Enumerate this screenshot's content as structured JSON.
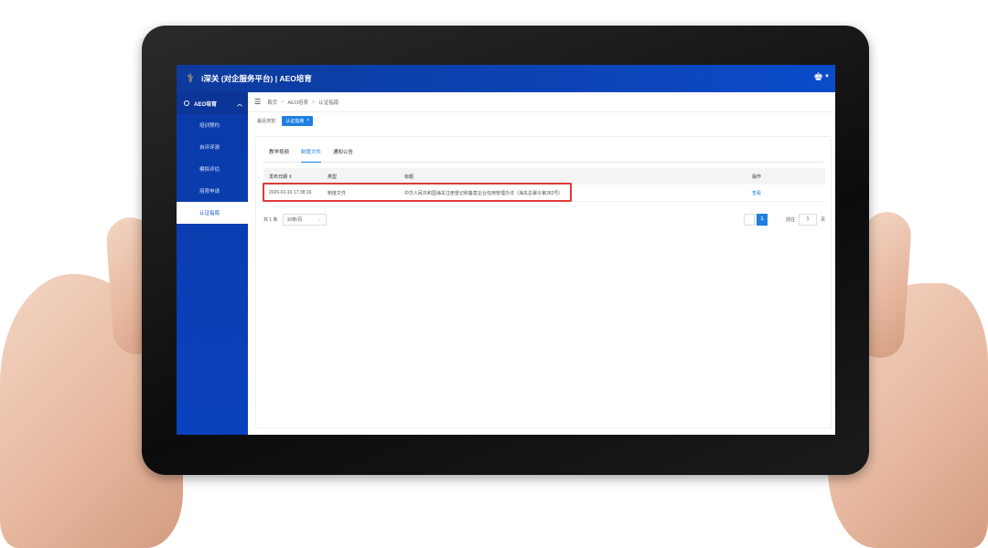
{
  "header": {
    "title": "i深关 (对企服务平台) | AEO培育"
  },
  "sidebar": {
    "group": "AEO培育",
    "items": [
      {
        "label": "培训预约"
      },
      {
        "label": "自评评测"
      },
      {
        "label": "模拟评估"
      },
      {
        "label": "培育申请"
      },
      {
        "label": "认证指南"
      }
    ]
  },
  "breadcrumb": {
    "items": [
      "首页",
      "AEO培育",
      "认证指南"
    ]
  },
  "tagbar": {
    "label": "最近浏览:",
    "active_tag": "认证指南"
  },
  "tabs": [
    {
      "label": "教学视频"
    },
    {
      "label": "制度文件"
    },
    {
      "label": "通知公告"
    }
  ],
  "table": {
    "headers": [
      "发布日期 ⇕",
      "类型",
      "标题",
      "操作"
    ],
    "rows": [
      {
        "date": "2026-01-16 17:38:16",
        "type": "制度文件",
        "title": "中华人民共和国海关注册登记和备案企业信用管理办法（海关总署令第282号）",
        "action": "查看"
      }
    ]
  },
  "pagination": {
    "total_text": "共 1 条",
    "page_size": "10条/页",
    "current_page": "1",
    "goto_label": "前往",
    "goto_value": "1",
    "page_suffix": "页"
  },
  "colors": {
    "brand": "#0b4bc9",
    "accent": "#1e7fe0",
    "highlight": "#e03a3a"
  }
}
